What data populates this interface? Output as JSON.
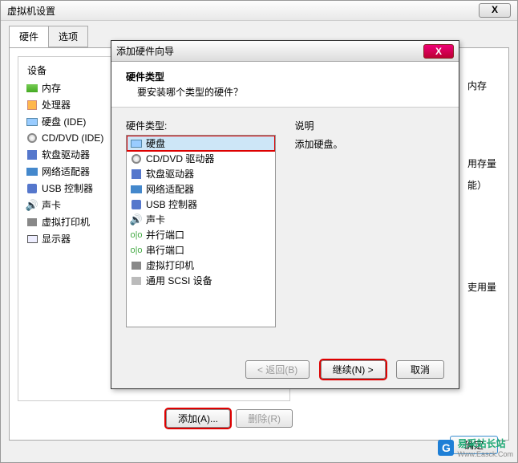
{
  "main": {
    "title": "虚拟机设置",
    "close": "X",
    "tabs": {
      "hardware": "硬件",
      "options": "选项"
    },
    "deviceHeader": "设备",
    "devices": [
      {
        "label": "内存",
        "icon": "memory"
      },
      {
        "label": "处理器",
        "icon": "cpu"
      },
      {
        "label": "硬盘 (IDE)",
        "icon": "disk"
      },
      {
        "label": "CD/DVD (IDE)",
        "icon": "cd"
      },
      {
        "label": "软盘驱动器",
        "icon": "floppy"
      },
      {
        "label": "网络适配器",
        "icon": "net"
      },
      {
        "label": "USB 控制器",
        "icon": "usb"
      },
      {
        "label": "声卡",
        "icon": "sound"
      },
      {
        "label": "虚拟打印机",
        "icon": "print"
      },
      {
        "label": "显示器",
        "icon": "display"
      }
    ],
    "sideLabels": {
      "mem": "内存",
      "swap": "用存量",
      "neng": "能）",
      "usage": "吏用量"
    },
    "addBtn": "添加(A)...",
    "removeBtn": "删除(R)",
    "ok": "确定"
  },
  "wizard": {
    "title": "添加硬件向导",
    "heading": "硬件类型",
    "subheading": "要安装哪个类型的硬件？",
    "listLabel": "硬件类型:",
    "descLabel": "说明",
    "descText": "添加硬盘。",
    "items": [
      {
        "label": "硬盘",
        "icon": "disk",
        "selected": true
      },
      {
        "label": "CD/DVD 驱动器",
        "icon": "cd"
      },
      {
        "label": "软盘驱动器",
        "icon": "floppy"
      },
      {
        "label": "网络适配器",
        "icon": "net"
      },
      {
        "label": "USB 控制器",
        "icon": "usb"
      },
      {
        "label": "声卡",
        "icon": "sound"
      },
      {
        "label": "并行端口",
        "icon": "port"
      },
      {
        "label": "串行端口",
        "icon": "port"
      },
      {
        "label": "虚拟打印机",
        "icon": "print"
      },
      {
        "label": "通用 SCSI 设备",
        "icon": "scsi"
      }
    ],
    "back": "< 返回(B)",
    "next": "继续(N) >",
    "cancel": "取消"
  },
  "watermark": {
    "text": "易采站长站",
    "sub": "Www.Easck.Com"
  }
}
